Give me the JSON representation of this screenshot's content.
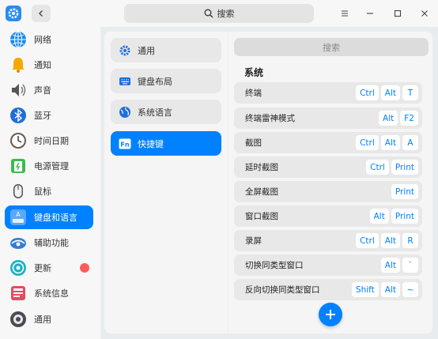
{
  "titlebar": {
    "search_label": "搜索"
  },
  "sidebar": {
    "items": [
      {
        "label": "网络",
        "icon": "network-globe-icon"
      },
      {
        "label": "通知",
        "icon": "bell-icon"
      },
      {
        "label": "声音",
        "icon": "speaker-icon"
      },
      {
        "label": "蓝牙",
        "icon": "bluetooth-icon"
      },
      {
        "label": "时间日期",
        "icon": "clock-icon"
      },
      {
        "label": "电源管理",
        "icon": "battery-icon"
      },
      {
        "label": "鼠标",
        "icon": "mouse-icon"
      },
      {
        "label": "键盘和语言",
        "icon": "keyboard-icon",
        "active": true
      },
      {
        "label": "辅助功能",
        "icon": "accessibility-icon"
      },
      {
        "label": "更新",
        "icon": "update-icon",
        "badge": true
      },
      {
        "label": "系统信息",
        "icon": "system-info-icon"
      },
      {
        "label": "通用",
        "icon": "general-icon"
      }
    ]
  },
  "middle": {
    "items": [
      {
        "label": "通用",
        "icon": "gear-icon"
      },
      {
        "label": "键盘布局",
        "icon": "keyboard-layout-icon"
      },
      {
        "label": "系统语言",
        "icon": "language-globe-icon"
      },
      {
        "label": "快捷键",
        "icon": "fn-key-icon",
        "active": true
      }
    ]
  },
  "shortcuts": {
    "search_placeholder": "搜索",
    "section_title": "系统",
    "rows": [
      {
        "label": "终端",
        "keys": [
          "Ctrl",
          "Alt",
          "T"
        ]
      },
      {
        "label": "终端雷神模式",
        "keys": [
          "Alt",
          "F2"
        ]
      },
      {
        "label": "截图",
        "keys": [
          "Ctrl",
          "Alt",
          "A"
        ]
      },
      {
        "label": "延时截图",
        "keys": [
          "Ctrl",
          "Print"
        ]
      },
      {
        "label": "全屏截图",
        "keys": [
          "Print"
        ]
      },
      {
        "label": "窗口截图",
        "keys": [
          "Alt",
          "Print"
        ]
      },
      {
        "label": "录屏",
        "keys": [
          "Ctrl",
          "Alt",
          "R"
        ]
      },
      {
        "label": "切换同类型窗口",
        "keys": [
          "Alt",
          "`"
        ]
      },
      {
        "label": "反向切换同类型窗口",
        "keys": [
          "Shift",
          "Alt",
          "~"
        ]
      }
    ]
  },
  "colors": {
    "accent": "#0081ff",
    "badge": "#ff5b5b"
  }
}
